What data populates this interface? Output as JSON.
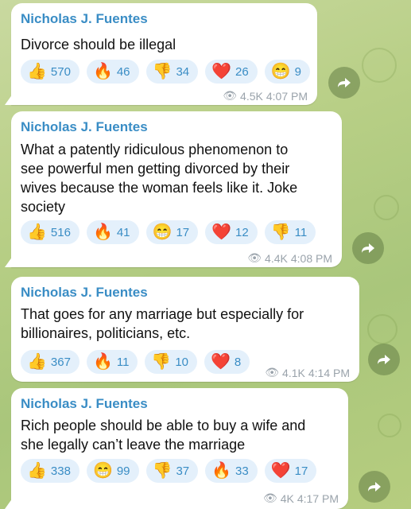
{
  "messages": [
    {
      "sender": "Nicholas J. Fuentes",
      "text": [
        "Divorce should be illegal"
      ],
      "reactions": [
        {
          "emoji": "👍",
          "count": "570"
        },
        {
          "emoji": "🔥",
          "count": "46"
        },
        {
          "emoji": "👎",
          "count": "34"
        },
        {
          "emoji": "❤️",
          "count": "26"
        },
        {
          "emoji": "😁",
          "count": "9"
        }
      ],
      "views": "4.5K",
      "time": "4:07 PM"
    },
    {
      "sender": "Nicholas J. Fuentes",
      "text": [
        "What a patently ridiculous phenomenon to",
        "see powerful men getting divorced by their",
        "wives because the woman feels like it. Joke",
        "society"
      ],
      "reactions": [
        {
          "emoji": "👍",
          "count": "516"
        },
        {
          "emoji": "🔥",
          "count": "41"
        },
        {
          "emoji": "😁",
          "count": "17"
        },
        {
          "emoji": "❤️",
          "count": "12"
        },
        {
          "emoji": "👎",
          "count": "11"
        }
      ],
      "views": "4.4K",
      "time": "4:08 PM"
    },
    {
      "sender": "Nicholas J. Fuentes",
      "text": [
        "That goes for any marriage but especially for",
        "billionaires, politicians, etc."
      ],
      "reactions": [
        {
          "emoji": "👍",
          "count": "367"
        },
        {
          "emoji": "🔥",
          "count": "11"
        },
        {
          "emoji": "👎",
          "count": "10"
        },
        {
          "emoji": "❤️",
          "count": "8"
        }
      ],
      "views": "4.1K",
      "time": "4:14 PM"
    },
    {
      "sender": "Nicholas J. Fuentes",
      "text": [
        "Rich people should be able to buy a wife and",
        "she legally can’t leave the marriage"
      ],
      "reactions": [
        {
          "emoji": "👍",
          "count": "338"
        },
        {
          "emoji": "😁",
          "count": "99"
        },
        {
          "emoji": "👎",
          "count": "37"
        },
        {
          "emoji": "🔥",
          "count": "33"
        },
        {
          "emoji": "❤️",
          "count": "17"
        }
      ],
      "views": "4K",
      "time": "4:17 PM"
    }
  ],
  "icons": {
    "share": "share-arrow-icon",
    "views": "eye-icon"
  },
  "colors": {
    "sender": "#3a8dc5",
    "reaction_bg": "#e4f0fb",
    "meta": "#9aa3ab"
  }
}
